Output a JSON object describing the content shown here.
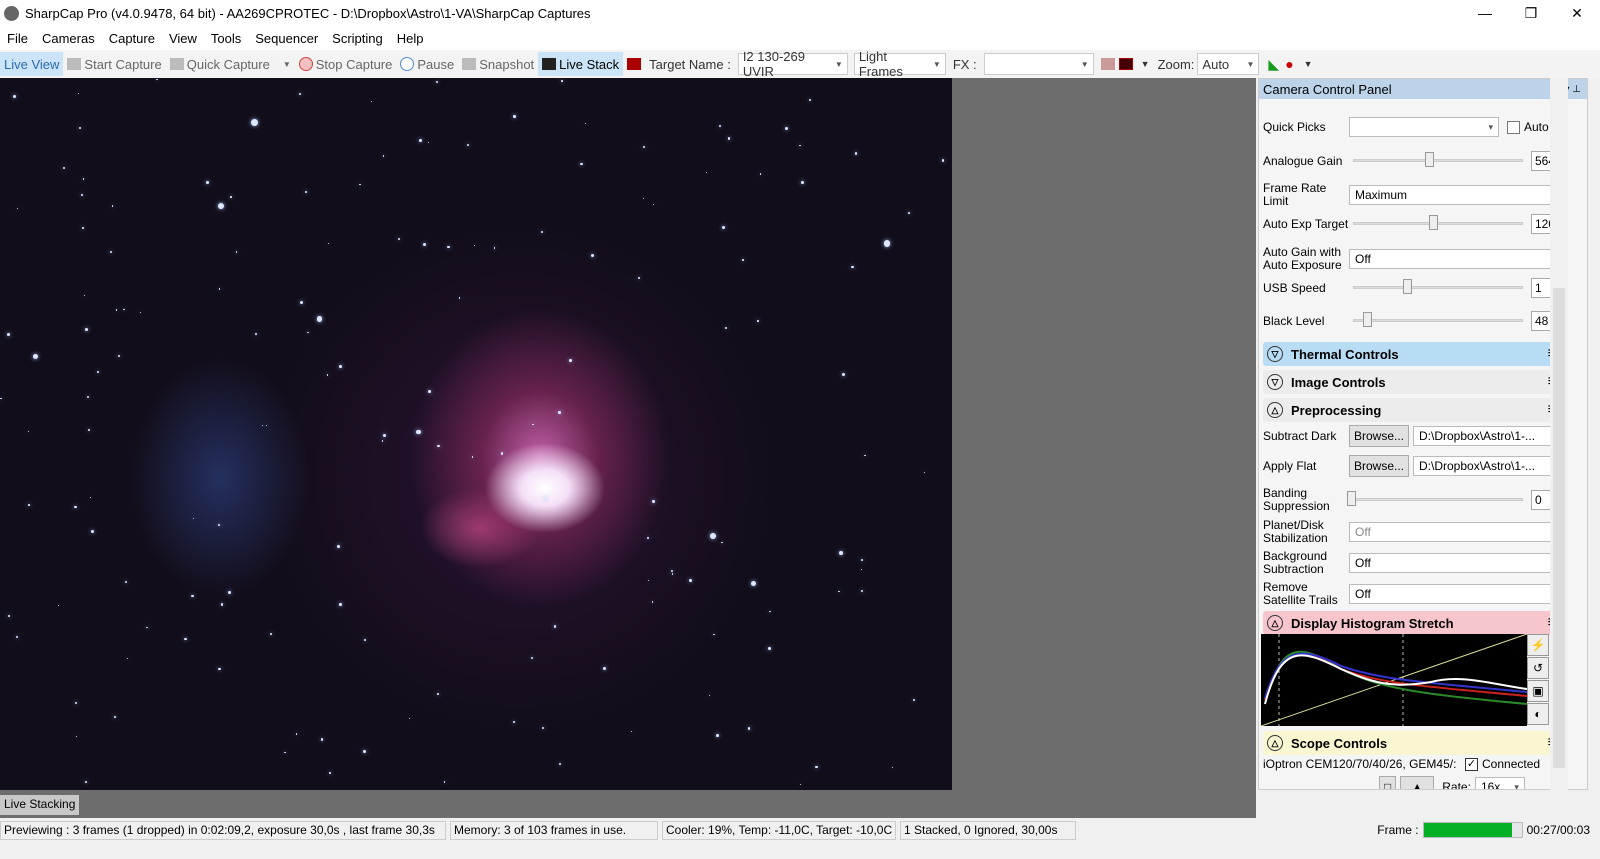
{
  "window": {
    "title": "SharpCap Pro (v4.0.9478, 64 bit) - AA269CPROTEC - D:\\Dropbox\\Astro\\1-VA\\SharpCap Captures",
    "minimize": "—",
    "restore": "❐",
    "close": "✕"
  },
  "menu": [
    "File",
    "Cameras",
    "Capture",
    "View",
    "Tools",
    "Sequencer",
    "Scripting",
    "Help"
  ],
  "toolbar": {
    "live_view": "Live View",
    "start_capture": "Start Capture",
    "quick_capture": "Quick Capture",
    "stop_capture": "Stop Capture",
    "pause": "Pause",
    "snapshot": "Snapshot",
    "live_stack": "Live Stack",
    "target_label": "Target Name :",
    "target_value": "I2 130-269 UVIR",
    "frame_type": "Light Frames",
    "fx_label": "FX :",
    "fx_value": "",
    "zoom_label": "Zoom:",
    "zoom_value": "Auto"
  },
  "panel": {
    "title": "Camera Control Panel",
    "quick_picks_label": "Quick Picks",
    "quick_picks_value": "",
    "auto_label": "Auto",
    "analogue_gain": {
      "label": "Analogue Gain",
      "value": "564",
      "level": 0.45
    },
    "frame_rate": {
      "label": "Frame Rate Limit",
      "value": "Maximum"
    },
    "auto_exp": {
      "label": "Auto Exp Target",
      "value": "120",
      "level": 0.47
    },
    "auto_gain": {
      "label": "Auto Gain with Auto Exposure",
      "value": "Off"
    },
    "usb_speed": {
      "label": "USB Speed",
      "value": "1",
      "level": 0.32
    },
    "black_level": {
      "label": "Black Level",
      "value": "48",
      "level": 0.09
    },
    "sections": {
      "thermal": "Thermal Controls",
      "image": "Image Controls",
      "preprocessing": "Preprocessing",
      "histogram": "Display Histogram Stretch",
      "scope": "Scope Controls"
    },
    "section_colors": {
      "thermal": "#b9dcf5",
      "image": "#ececec",
      "preprocessing": "#ececec",
      "histogram": "#f7c6cc",
      "scope": "#fbf6d2"
    },
    "subtract_dark": {
      "label": "Subtract Dark",
      "button": "Browse...",
      "value": "D:\\Dropbox\\Astro\\1-..."
    },
    "apply_flat": {
      "label": "Apply Flat",
      "button": "Browse...",
      "value": "D:\\Dropbox\\Astro\\1-..."
    },
    "banding": {
      "label": "Banding Suppression",
      "value": "0",
      "level": 0
    },
    "stabilization": {
      "label": "Planet/Disk Stabilization",
      "value": "Off"
    },
    "background": {
      "label": "Background Subtraction",
      "value": "Off"
    },
    "satellite": {
      "label": "Remove Satellite Trails",
      "value": "Off"
    },
    "scope": {
      "mount": "iOptron CEM120/70/40/26, GEM45/:",
      "connected": "Connected",
      "rate_label": "Rate:",
      "rate_value": "16x"
    }
  },
  "live_stacking_tab": "Live Stacking",
  "status": {
    "preview": "Previewing : 3 frames (1 dropped) in 0:02:09,2, exposure 30,0s , last frame 30,3s",
    "memory": "Memory: 3 of 103 frames in use.",
    "cooler": "Cooler: 19%, Temp: -11,0C, Target: -10,0C",
    "stacked": "1 Stacked, 0 Ignored, 30,00s",
    "frame_label": "Frame :",
    "frame_progress": 0.9,
    "frame_time": "00:27/00:03",
    "progress_color": "#06b025"
  }
}
